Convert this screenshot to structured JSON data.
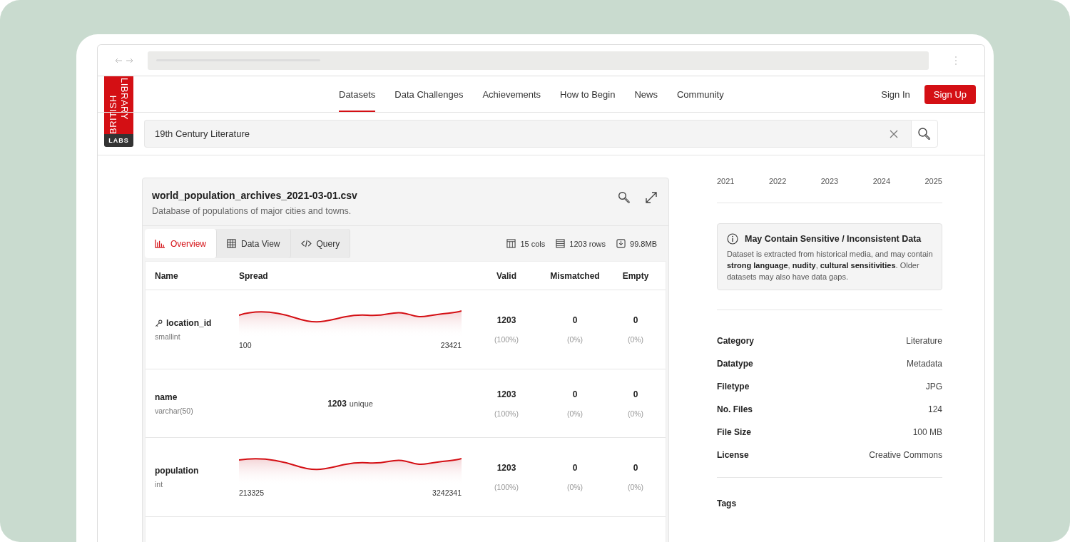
{
  "nav": {
    "items": [
      {
        "label": "Datasets",
        "selected": true
      },
      {
        "label": "Data Challenges",
        "selected": false
      },
      {
        "label": "Achievements",
        "selected": false
      },
      {
        "label": "How to Begin",
        "selected": false
      },
      {
        "label": "News",
        "selected": false
      },
      {
        "label": "Community",
        "selected": false
      }
    ],
    "sign_in": "Sign In",
    "sign_up": "Sign Up"
  },
  "logo": {
    "lines": [
      "BRITISH",
      "LIBRARY"
    ],
    "sub": "LABS"
  },
  "search": {
    "value": "19th Century Literature"
  },
  "dataset": {
    "title": "world_population_archives_2021-03-01.csv",
    "description": "Database of populations of major cities and towns.",
    "tabs": [
      {
        "label": "Overview",
        "kind": "chart",
        "selected": true
      },
      {
        "label": "Data View",
        "kind": "table",
        "selected": false
      },
      {
        "label": "Query",
        "kind": "code",
        "selected": false
      }
    ],
    "stats": [
      {
        "kind": "cols",
        "label": "15 cols"
      },
      {
        "kind": "rows",
        "label": "1203 rows"
      },
      {
        "kind": "size",
        "label": "99.8MB"
      }
    ],
    "columns": [
      "Name",
      "Spread",
      "Valid",
      "Mismatched",
      "Empty"
    ],
    "rows": [
      {
        "name": "location_id",
        "type": "smallint",
        "key": true,
        "spread": {
          "kind": "range",
          "min": "100",
          "max": "23421"
        },
        "valid": "1203",
        "valid_pct": "(100%)",
        "mismatched": "0",
        "mismatched_pct": "(0%)",
        "empty": "0",
        "empty_pct": "(0%)"
      },
      {
        "name": "name",
        "type": "varchar(50)",
        "key": false,
        "spread": {
          "kind": "unique",
          "count": "1203",
          "label": "unique"
        },
        "valid": "1203",
        "valid_pct": "(100%)",
        "mismatched": "0",
        "mismatched_pct": "(0%)",
        "empty": "0",
        "empty_pct": "(0%)"
      },
      {
        "name": "population",
        "type": "int",
        "key": false,
        "spread": {
          "kind": "range",
          "min": "213325",
          "max": "3242341"
        },
        "valid": "1203",
        "valid_pct": "(100%)",
        "mismatched": "0",
        "mismatched_pct": "(0%)",
        "empty": "0",
        "empty_pct": "(0%)"
      }
    ]
  },
  "timeline": {
    "years": [
      "2021",
      "2022",
      "2023",
      "2024",
      "2025"
    ]
  },
  "notice": {
    "title": "May Contain Sensitive / Inconsistent Data",
    "body": "Dataset is extracted from historical media, and may contain **strong language**, **nudity**, **cultural sensitivities**. Older datasets may also have data gaps."
  },
  "details": [
    {
      "label": "Category",
      "value": "Literature"
    },
    {
      "label": "Datatype",
      "value": "Metadata"
    },
    {
      "label": "Filetype",
      "value": "JPG"
    },
    {
      "label": "No. Files",
      "value": "124"
    },
    {
      "label": "File Size",
      "value": "100 MB"
    },
    {
      "label": "License",
      "value": "Creative Commons"
    }
  ],
  "tags_heading": "Tags"
}
